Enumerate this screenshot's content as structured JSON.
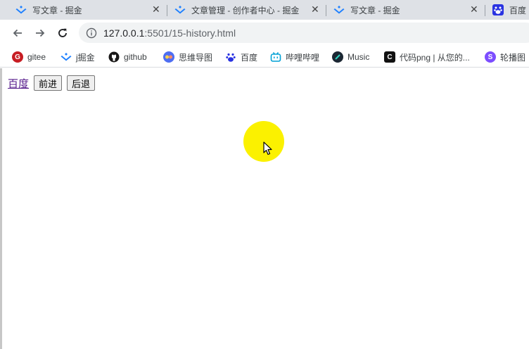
{
  "tabs": [
    {
      "title": "写文章 - 掘金",
      "icon": "juejin-icon"
    },
    {
      "title": "文章管理 - 创作者中心 - 掘金",
      "icon": "juejin-icon"
    },
    {
      "title": "写文章 - 掘金",
      "icon": "juejin-icon"
    },
    {
      "title": "百度",
      "icon": "baidu-icon"
    }
  ],
  "tab_close_glyph": "✕",
  "toolbar": {
    "url_host": "127.0.0.1",
    "url_rest": ":5501/15-history.html"
  },
  "bookmarks": [
    {
      "label": "gitee",
      "icon": "gitee-icon"
    },
    {
      "label": "j掘金",
      "icon": "juejin-icon"
    },
    {
      "label": "github",
      "icon": "github-icon"
    },
    {
      "label": "思维导图",
      "icon": "mindmap-icon"
    },
    {
      "label": "百度",
      "icon": "baidu-icon"
    },
    {
      "label": "哔哩哔哩",
      "icon": "bilibili-icon"
    },
    {
      "label": "Music",
      "icon": "music-icon"
    },
    {
      "label": "代码png | 从您的...",
      "icon": "carbon-icon"
    },
    {
      "label": "轮播图",
      "icon": "s-icon"
    }
  ],
  "page": {
    "link_text": "百度",
    "forward_label": "前进",
    "back_label": "后退"
  },
  "colors": {
    "tabstrip": "#dee1e6",
    "cursor_highlight": "#fbf100",
    "visited_link": "#551a8b"
  }
}
